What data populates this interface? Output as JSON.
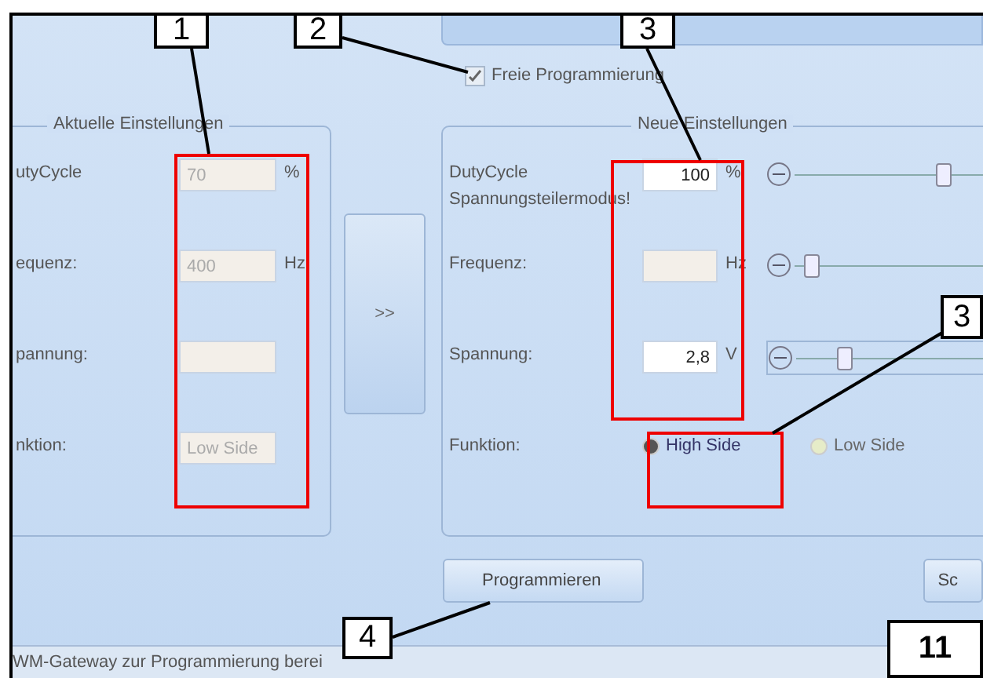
{
  "checkbox": {
    "label": "Freie Programmierung",
    "checked": true
  },
  "current_settings": {
    "title": "Aktuelle Einstellungen",
    "rows": [
      {
        "label": "utyCycle",
        "value": "70",
        "unit": "%"
      },
      {
        "label": "equenz:",
        "value": "400",
        "unit": "Hz"
      },
      {
        "label": "pannung:",
        "value": ""
      },
      {
        "label": "nktion:",
        "value": "Low Side"
      }
    ]
  },
  "transfer_button": ">>",
  "new_settings": {
    "title": "Neue Einstellungen",
    "rows": [
      {
        "kind": "slider",
        "label": "DutyCycle",
        "note": "Spannungsteilermodus!",
        "value": "100",
        "unit": "%",
        "disabled": false,
        "level": 0.75
      },
      {
        "kind": "slider",
        "label": "Frequenz:",
        "value": "",
        "unit": "Hz",
        "disabled": true,
        "level": 0.05
      },
      {
        "kind": "slider",
        "label": "Spannung:",
        "value": "2,8",
        "unit": "V",
        "disabled": false,
        "level": 0.22
      },
      {
        "kind": "radio",
        "label": "Funktion:",
        "options": [
          {
            "label": "High Side",
            "selected": true
          },
          {
            "label": "Low Side",
            "selected": false
          }
        ]
      }
    ]
  },
  "buttons": [
    "Programmieren",
    "Sc"
  ],
  "status_bar": "WM-Gateway zur Programmierung berei",
  "callouts": [
    {
      "label": "1"
    },
    {
      "label": "2"
    },
    {
      "label": "3"
    },
    {
      "label": "3"
    },
    {
      "label": "4"
    }
  ],
  "page_number": "11"
}
